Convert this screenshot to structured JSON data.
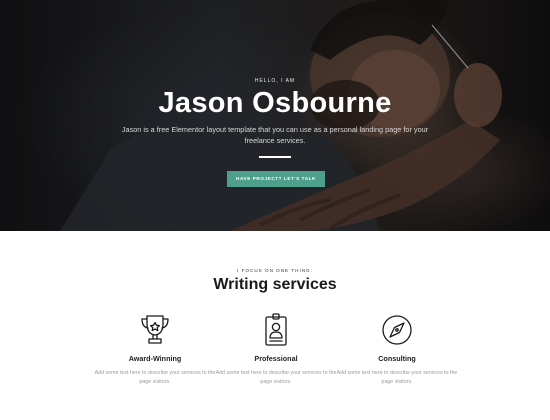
{
  "hero": {
    "eyebrow": "HELLO, I AM",
    "title": "Jason Osbourne",
    "description": "Jason is a free Elementor layout template that you can use as a personal landing page for your freelance services.",
    "cta_label": "HAVE PROJECT? LET'S TALK",
    "cta_color": "#4fa08b"
  },
  "services": {
    "eyebrow": "I FOCUS ON ONE THING:",
    "title": "Writing services",
    "items": [
      {
        "icon": "trophy-icon",
        "title": "Award-Winning",
        "text": "Add some text here to describe your services to the page visitors."
      },
      {
        "icon": "id-badge-icon",
        "title": "Professional",
        "text": "Add some text here to describe your services to the page visitors."
      },
      {
        "icon": "compass-icon",
        "title": "Consulting",
        "text": "Add some text here to describe your services to the page visitors."
      }
    ]
  }
}
